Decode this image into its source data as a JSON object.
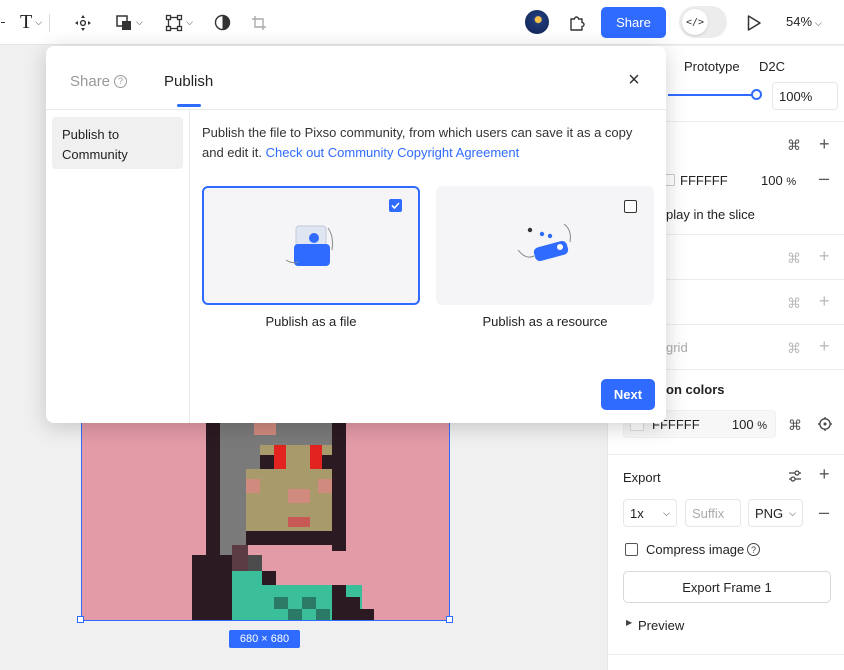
{
  "toolbar": {
    "share_label": "Share",
    "zoom": "54%",
    "code_glyph": "</>"
  },
  "canvas": {
    "size_badge": "680 × 680"
  },
  "panel": {
    "tabs": [
      "Prototype",
      "D2C"
    ],
    "opacity": "100%",
    "fill_hex": "FFFFFF",
    "fill_opacity": "100",
    "fill_opacity_unit": "%",
    "clip_text": "play in the slice",
    "layout_grid": "grid",
    "selection_colors": "on colors",
    "selection_hex": "FFFFFF",
    "selection_opacity": "100",
    "selection_opacity_unit": "%",
    "export_title": "Export",
    "export_scale": "1x",
    "export_suffix_placeholder": "Suffix",
    "export_format": "PNG",
    "compress_label": "Compress image",
    "export_button": "Export Frame 1",
    "preview_label": "Preview"
  },
  "modal": {
    "tab_share": "Share",
    "tab_publish": "Publish",
    "sidebar_item": "Publish to Community",
    "description": "Publish the file to Pixso community, from which users can save it as a copy and edit it.",
    "link": "Check out Community Copyright Agreement",
    "option_file": "Publish as a file",
    "option_resource": "Publish as a resource",
    "next": "Next"
  },
  "colors": {
    "accent": "#2f6bff",
    "frame_bg": "#e39ba8"
  }
}
